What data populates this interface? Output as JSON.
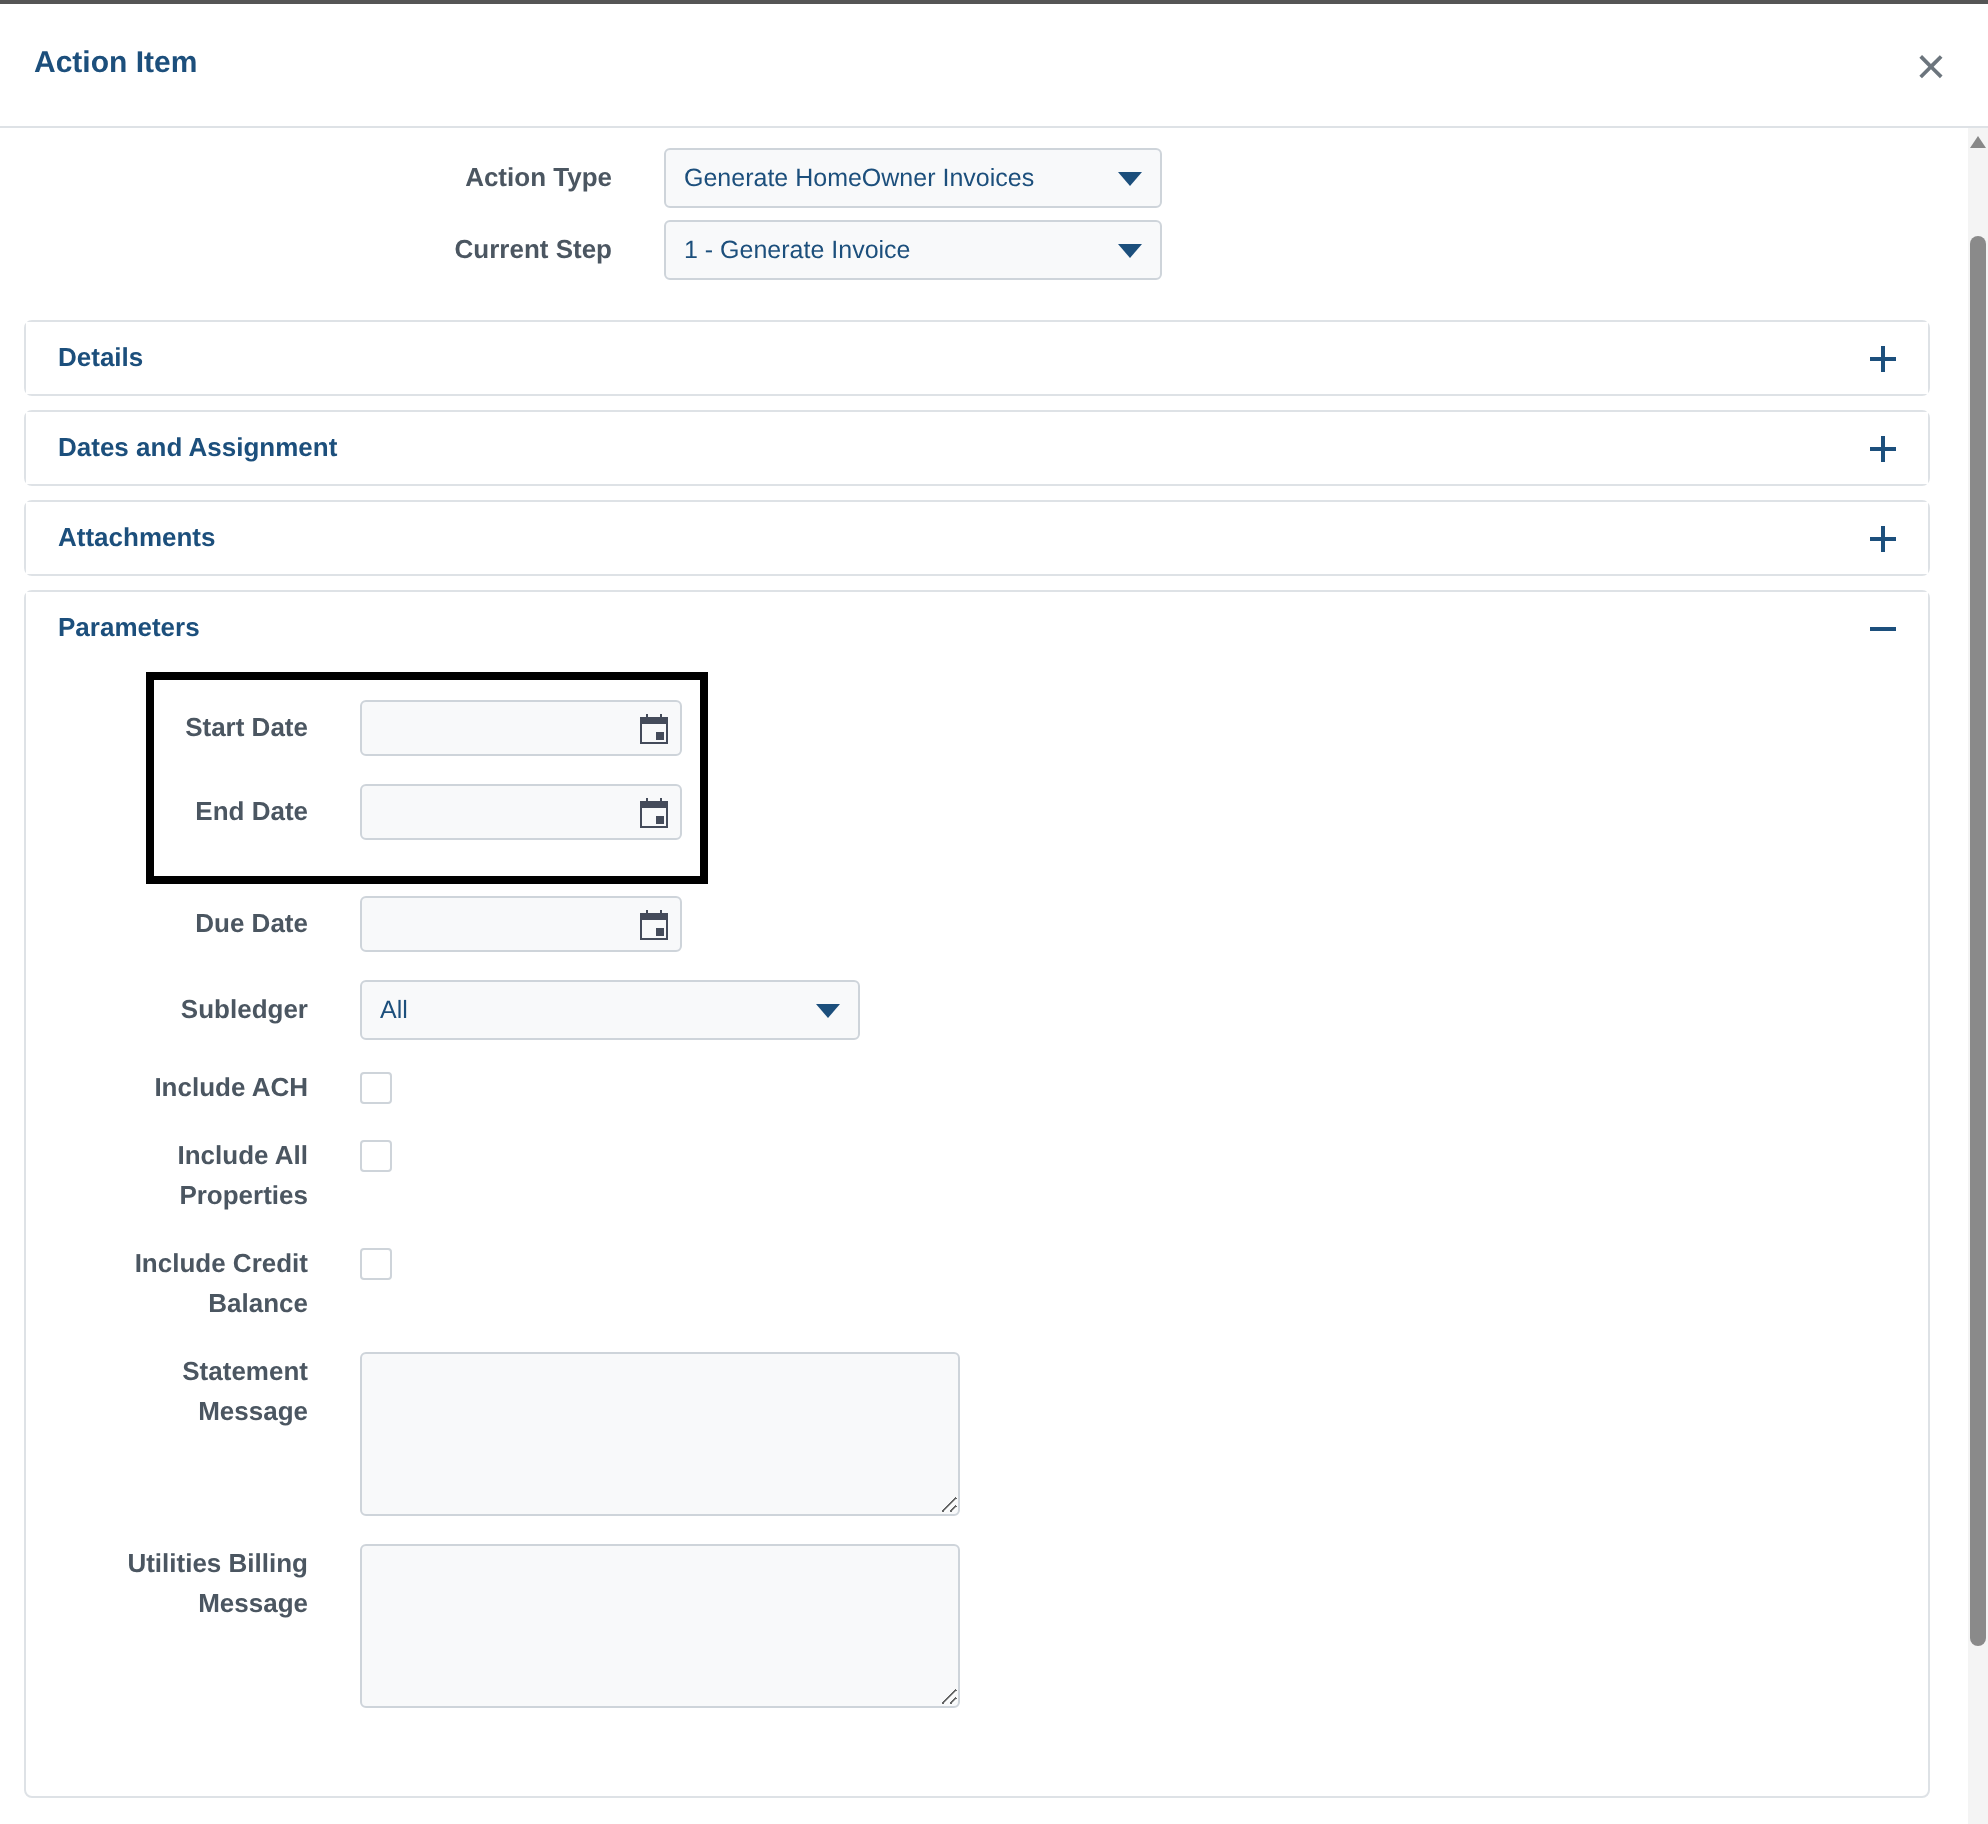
{
  "window": {
    "title": "Action Item",
    "close": "×"
  },
  "top_fields": [
    {
      "label": "Action Type",
      "value": "Generate HomeOwner Invoices"
    },
    {
      "label": "Current Step",
      "value": "1 - Generate Invoice"
    }
  ],
  "sections": [
    {
      "title": "Details",
      "expanded": false
    },
    {
      "title": "Dates and Assignment",
      "expanded": false
    },
    {
      "title": "Attachments",
      "expanded": false
    },
    {
      "title": "Parameters",
      "expanded": true
    }
  ],
  "parameters": [
    {
      "kind": "date",
      "label": "Start Date",
      "highlighted": true
    },
    {
      "kind": "date",
      "label": "End Date",
      "highlighted": true
    },
    {
      "kind": "date",
      "label": "Due Date",
      "highlighted": false
    },
    {
      "kind": "select",
      "label": "Subledger",
      "value": "All",
      "highlighted": false
    },
    {
      "kind": "checkbox",
      "label": "Include ACH",
      "checked": false,
      "highlighted": false
    },
    {
      "kind": "checkbox",
      "label": "Include All Properties",
      "checked": false,
      "highlighted": false
    },
    {
      "kind": "checkbox",
      "label": "Include Credit Balance",
      "checked": false,
      "highlighted": false
    },
    {
      "kind": "textarea",
      "label": "Statement Message",
      "highlighted": false
    },
    {
      "kind": "textarea",
      "label": "Utilities Billing Message",
      "highlighted": false
    }
  ]
}
